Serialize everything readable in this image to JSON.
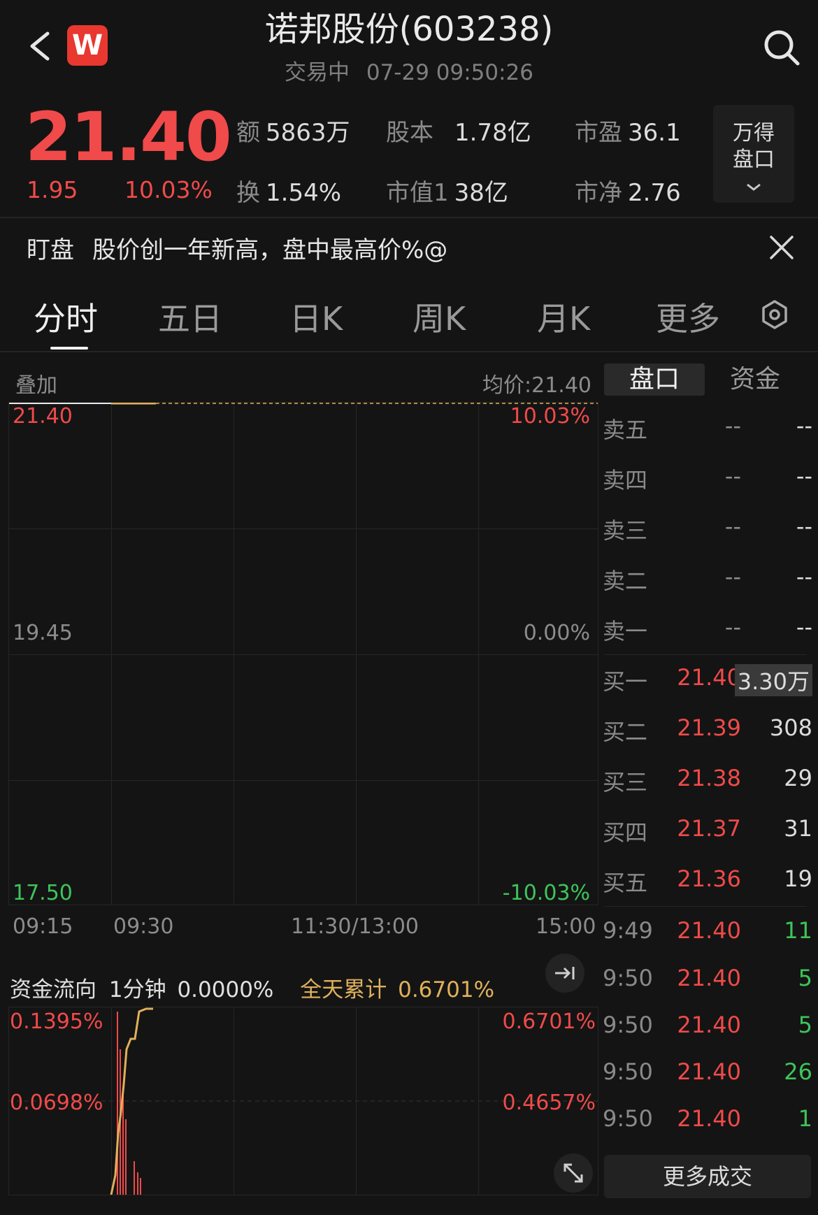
{
  "header": {
    "title": "诺邦股份(603238)",
    "status": "交易中",
    "datetime": "07-29 09:50:26",
    "logo_letter": "W"
  },
  "quote": {
    "price": "21.40",
    "change": "1.95",
    "change_pct": "10.03%",
    "stats": [
      {
        "key": "额",
        "value": "5863万"
      },
      {
        "key": "股本",
        "value": "1.78亿"
      },
      {
        "key": "市盈",
        "value": "36.1"
      },
      {
        "key": "换",
        "value": "1.54%"
      },
      {
        "key": "市值1",
        "value": "38亿"
      },
      {
        "key": "市净",
        "value": "2.76"
      }
    ],
    "pankou_button": [
      "万得",
      "盘口"
    ]
  },
  "alert": {
    "tag": "盯盘",
    "text": "股价创一年新高，盘中最高价%@"
  },
  "tabs": [
    "分时",
    "五日",
    "日K",
    "周K",
    "月K",
    "更多"
  ],
  "chart": {
    "overlay_label": "叠加",
    "avg_price": "均价:21.40",
    "left_axis": [
      "21.40",
      "19.45",
      "17.50"
    ],
    "right_axis": [
      "10.03%",
      "0.00%",
      "-10.03%"
    ],
    "x_labels": [
      "09:15",
      "09:30",
      "11:30/13:00",
      "15:00"
    ]
  },
  "panel_tabs": [
    "盘口",
    "资金"
  ],
  "order_book": {
    "asks": [
      {
        "label": "卖五",
        "price": "--",
        "volume": "--"
      },
      {
        "label": "卖四",
        "price": "--",
        "volume": "--"
      },
      {
        "label": "卖三",
        "price": "--",
        "volume": "--"
      },
      {
        "label": "卖二",
        "price": "--",
        "volume": "--"
      },
      {
        "label": "卖一",
        "price": "--",
        "volume": "--"
      }
    ],
    "bids": [
      {
        "label": "买一",
        "price": "21.40",
        "volume": "3.30万"
      },
      {
        "label": "买二",
        "price": "21.39",
        "volume": "308"
      },
      {
        "label": "买三",
        "price": "21.38",
        "volume": "29"
      },
      {
        "label": "买四",
        "price": "21.37",
        "volume": "31"
      },
      {
        "label": "买五",
        "price": "21.36",
        "volume": "19"
      }
    ]
  },
  "trades": [
    {
      "time": "9:49",
      "price": "21.40",
      "volume": "11"
    },
    {
      "time": "9:50",
      "price": "21.40",
      "volume": "5"
    },
    {
      "time": "9:50",
      "price": "21.40",
      "volume": "5"
    },
    {
      "time": "9:50",
      "price": "21.40",
      "volume": "26"
    },
    {
      "time": "9:50",
      "price": "21.40",
      "volume": "1"
    }
  ],
  "more_trades": "更多成交",
  "flow": {
    "title": "资金流向",
    "period": "1分钟",
    "period_value": "0.0000%",
    "cumulative_label": "全天累计",
    "cumulative_value": "0.6701%",
    "left_axis": [
      "0.1395%",
      "0.0698%"
    ],
    "right_axis": [
      "0.6701%",
      "0.4657%"
    ]
  },
  "colors": {
    "up": "#f04a4a",
    "down": "#3ec45a",
    "accent_gold": "#e0b15a",
    "background": "#141414"
  }
}
